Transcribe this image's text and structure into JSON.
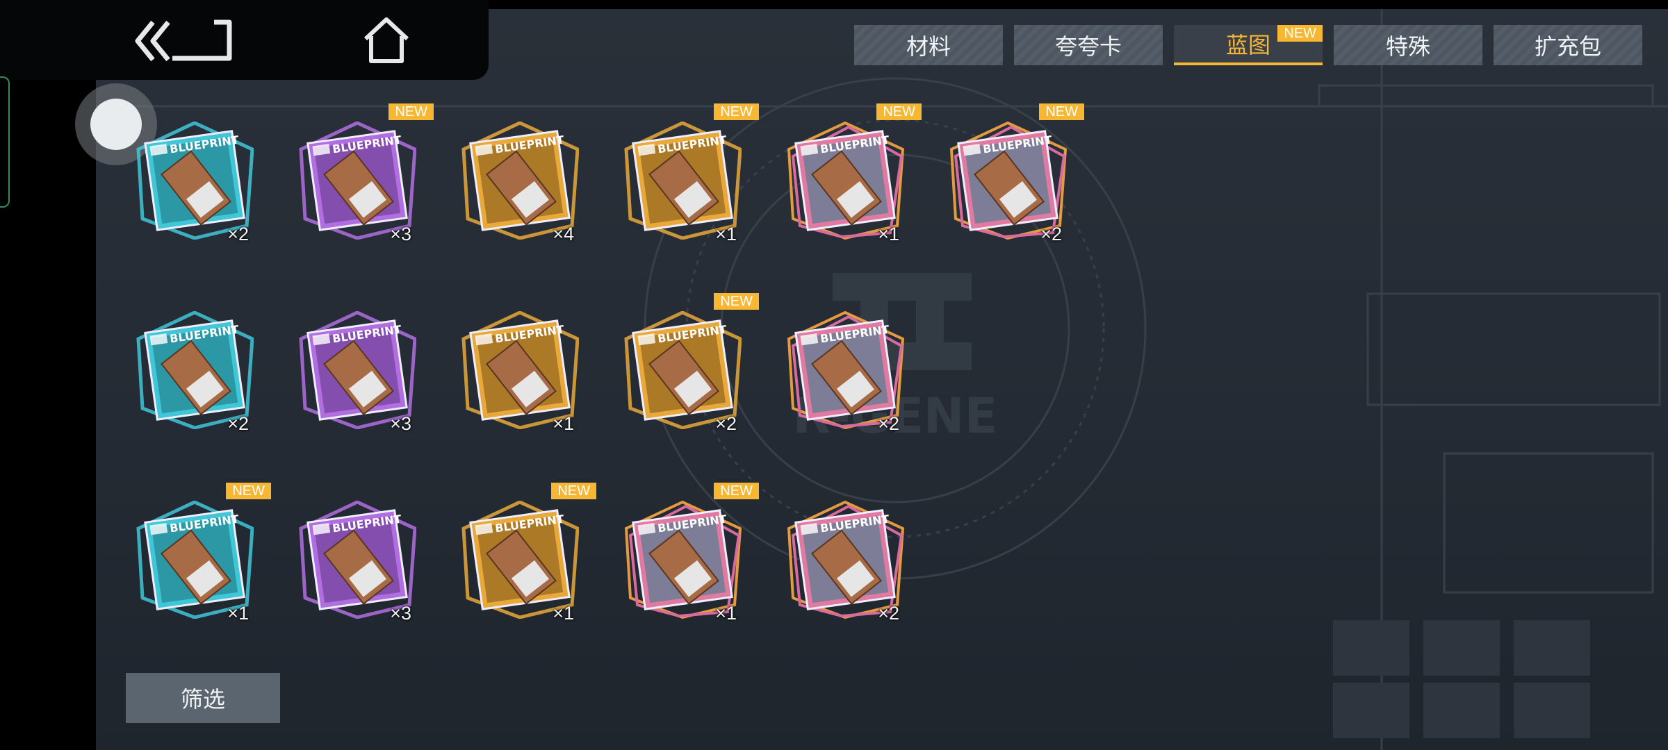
{
  "tabs": [
    {
      "label": "材料",
      "active": false,
      "new": false
    },
    {
      "label": "夸夸卡",
      "active": false,
      "new": false
    },
    {
      "label": "蓝图",
      "active": true,
      "new": true
    },
    {
      "label": "特殊",
      "active": false,
      "new": false
    },
    {
      "label": "扩充包",
      "active": false,
      "new": false
    }
  ],
  "badge_text": "NEW",
  "card_text": "BLUEPRINT",
  "background_logo": "R-GENE",
  "filter_label": "筛选",
  "rarity_colors": {
    "blue": "#3fc7d8",
    "purple": "#b06ee0",
    "gold": "#e8a93a",
    "colorful": "#e07aa0"
  },
  "items": [
    {
      "rarity": "blue",
      "qty": "×2",
      "new": false
    },
    {
      "rarity": "purple",
      "qty": "×3",
      "new": true
    },
    {
      "rarity": "gold",
      "qty": "×4",
      "new": false
    },
    {
      "rarity": "gold",
      "qty": "×1",
      "new": true
    },
    {
      "rarity": "colorful",
      "qty": "×1",
      "new": true
    },
    {
      "rarity": "colorful",
      "qty": "×2",
      "new": true
    },
    {
      "rarity": "blue",
      "qty": "×2",
      "new": false
    },
    {
      "rarity": "purple",
      "qty": "×3",
      "new": false
    },
    {
      "rarity": "gold",
      "qty": "×1",
      "new": false
    },
    {
      "rarity": "gold",
      "qty": "×2",
      "new": true
    },
    {
      "rarity": "colorful",
      "qty": "×2",
      "new": false
    },
    {
      "rarity": "blue",
      "qty": "×1",
      "new": true
    },
    {
      "rarity": "purple",
      "qty": "×3",
      "new": false
    },
    {
      "rarity": "gold",
      "qty": "×1",
      "new": true
    },
    {
      "rarity": "colorful",
      "qty": "×1",
      "new": true
    },
    {
      "rarity": "colorful",
      "qty": "×2",
      "new": false
    }
  ]
}
